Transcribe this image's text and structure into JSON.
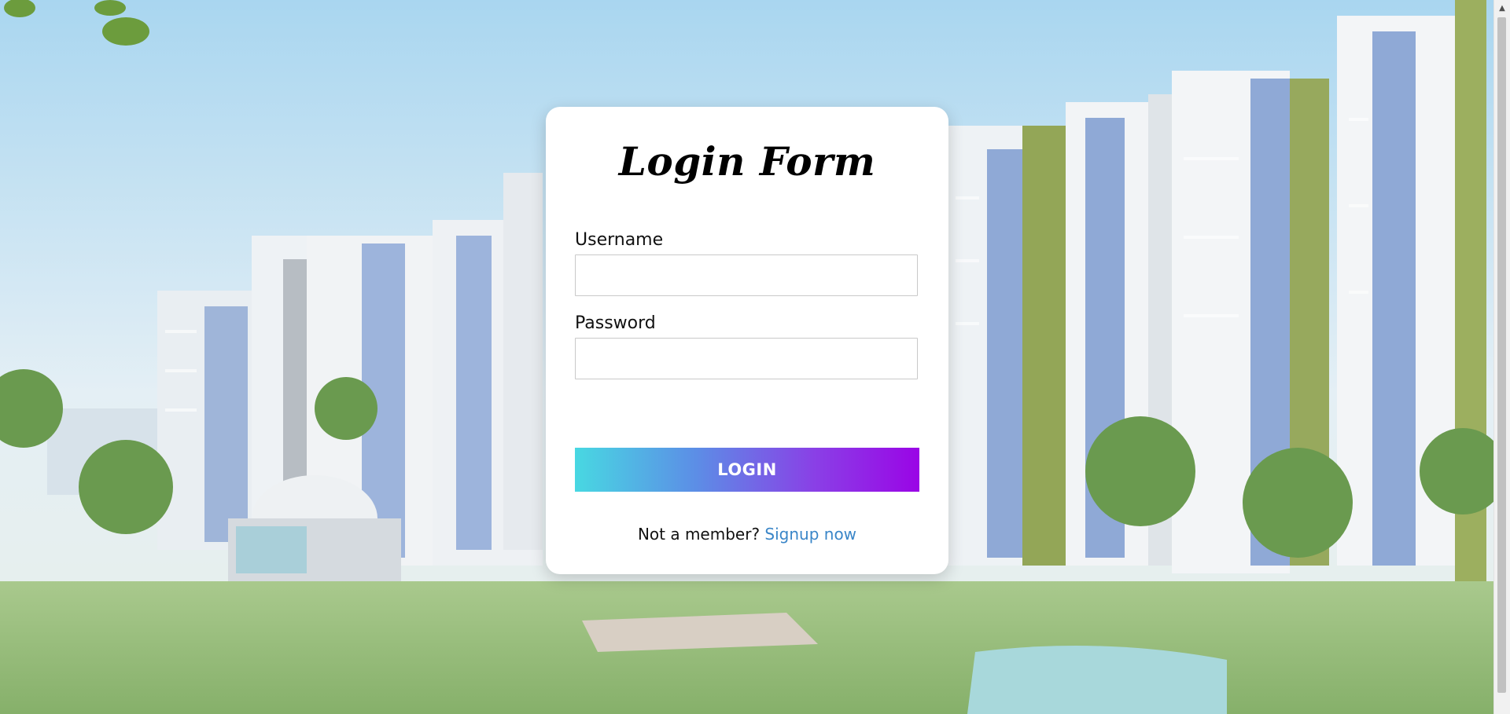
{
  "form": {
    "title": "Login Form",
    "username_label": "Username",
    "username_value": "",
    "password_label": "Password",
    "password_value": "",
    "login_button": "LOGIN",
    "signup_prompt": "Not a member?",
    "signup_link": "Signup now"
  },
  "colors": {
    "button_gradient_start": "#48d8e2",
    "button_gradient_end": "#9a05e6",
    "link": "#3a86c8",
    "card_background": "#ffffff"
  },
  "icons": {
    "scroll_up": "triangle-up"
  }
}
